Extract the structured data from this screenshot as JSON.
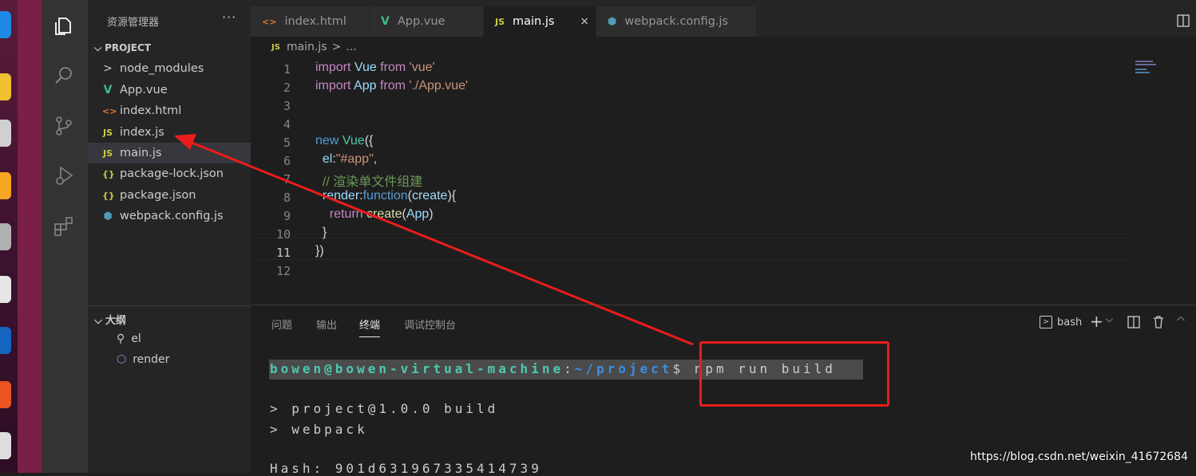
{
  "sidebar": {
    "title": "资源管理器",
    "more": "···",
    "project_label": "PROJECT",
    "files": [
      {
        "name": "node_modules",
        "icon": ">",
        "color": "#cccccc"
      },
      {
        "name": "App.vue",
        "icon": "V",
        "color": "#41b883"
      },
      {
        "name": "index.html",
        "icon": "<>",
        "color": "#e37933"
      },
      {
        "name": "index.js",
        "icon": "JS",
        "color": "#cbcb41"
      },
      {
        "name": "main.js",
        "icon": "JS",
        "color": "#cbcb41"
      },
      {
        "name": "package-lock.json",
        "icon": "{}",
        "color": "#cbcb41"
      },
      {
        "name": "package.json",
        "icon": "{}",
        "color": "#cbcb41"
      },
      {
        "name": "webpack.config.js",
        "icon": "⬢",
        "color": "#519aba"
      }
    ],
    "outline_label": "大纲",
    "outline": [
      {
        "name": "el"
      },
      {
        "name": "render"
      }
    ]
  },
  "tabs": [
    {
      "label": "index.html",
      "icon": "<>",
      "color": "#e37933"
    },
    {
      "label": "App.vue",
      "icon": "V",
      "color": "#41b883"
    },
    {
      "label": "main.js",
      "icon": "JS",
      "color": "#cbcb41",
      "close": "×"
    },
    {
      "label": "webpack.config.js",
      "icon": "⬢",
      "color": "#519aba"
    }
  ],
  "breadcrumb": {
    "icon": "JS",
    "file": "main.js",
    "sep": ">",
    "rest": "..."
  },
  "editor": {
    "line_numbers": [
      "1",
      "2",
      "3",
      "4",
      "5",
      "6",
      "7",
      "8",
      "9",
      "10",
      "11",
      "12"
    ],
    "lines": {
      "l1": [
        "import",
        " Vue ",
        "from",
        " 'vue'"
      ],
      "l2": [
        "import",
        " App ",
        "from",
        " './App.vue'"
      ],
      "l5": [
        "new",
        " Vue",
        "({"
      ],
      "l6": [
        "  el",
        ":",
        "\"#app\"",
        ","
      ],
      "l7": "  // 渲染单文件组建",
      "l8": [
        "  render",
        ":",
        "function",
        "(",
        "create",
        "){"
      ],
      "l9": [
        "    return",
        " create",
        "(",
        "App",
        ")"
      ],
      "l10": "  }",
      "l11": "})"
    }
  },
  "panel": {
    "tabs": [
      "问题",
      "输出",
      "终端",
      "调试控制台"
    ],
    "active_tab": "终端",
    "shell": "bash",
    "prompt_user": "bowen@bowen-virtual-machine",
    "prompt_colon": ":",
    "prompt_path": "~/project",
    "prompt_dollar": "$",
    "command": " npm run build ",
    "output": [
      "> project@1.0.0 build",
      "> webpack",
      "Hash: 901d631967335414739"
    ]
  },
  "watermark": "https://blog.csdn.net/weixin_41672684",
  "colors": {
    "annotation": "#ea1c1c",
    "accent": "#007acc"
  }
}
